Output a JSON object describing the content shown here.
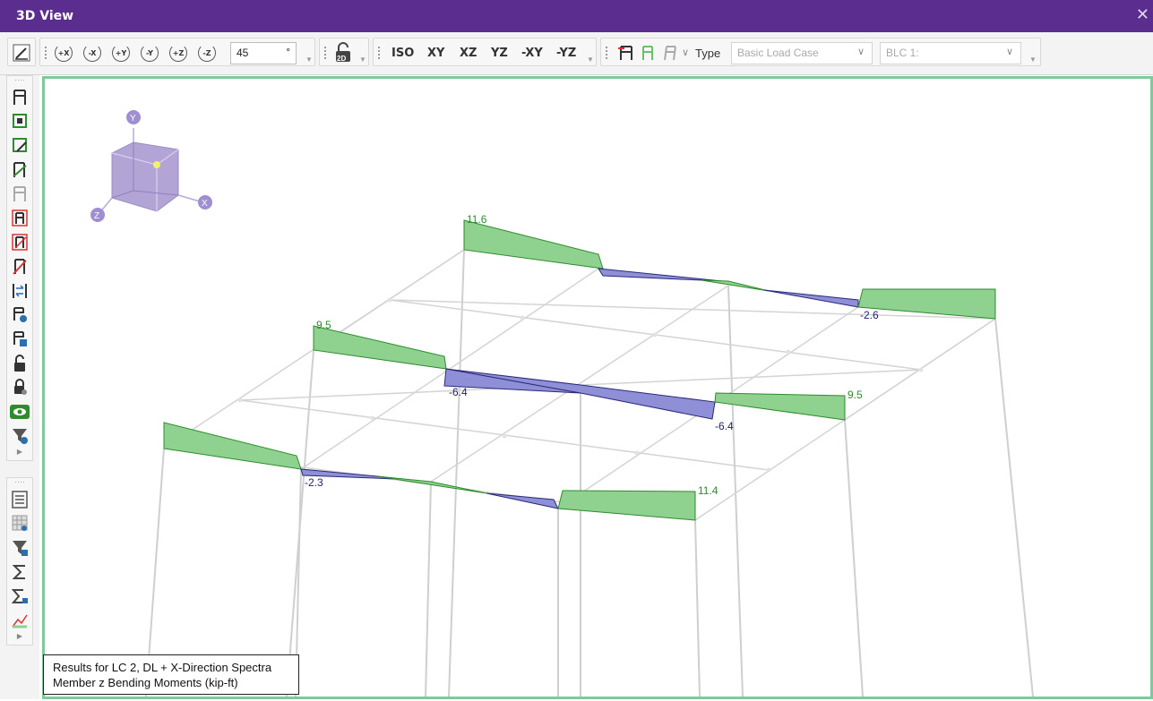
{
  "window": {
    "title": "3D View",
    "close_glyph": "✕"
  },
  "toolbar": {
    "rotate_buttons": [
      "+X",
      "-X",
      "+Y",
      "-Y",
      "+Z",
      "-Z"
    ],
    "rotation_angle": "45",
    "angle_unit": "°",
    "two_d_label": "2D",
    "view_buttons": [
      "ISO",
      "XY",
      "XZ",
      "YZ",
      "-XY",
      "-YZ"
    ],
    "type_label": "Type",
    "type_select": "Basic Load Case",
    "case_select": "BLC 1:"
  },
  "sidebar": {
    "section1": [
      "member-icon",
      "plate-icon",
      "plate-edit-icon",
      "member-edit-icon",
      "member-gray-icon",
      "member-red-icon",
      "member-red-edit-icon",
      "member-delete-icon",
      "member-sync-icon",
      "member-settings-icon",
      "member-save-icon",
      "lock-open-icon",
      "lock-view-icon",
      "eye-icon",
      "filter-icon"
    ],
    "section2": [
      "list-icon",
      "table-icon",
      "filter-list-icon",
      "sum-icon",
      "sum-table-icon",
      "chart-icon"
    ]
  },
  "colors": {
    "titlebar": "#5b2d8e",
    "positive_fill": "#8fd18f",
    "positive_stroke": "#2e8b2e",
    "negative_fill": "#8f8fd8",
    "negative_stroke": "#2a2a7a",
    "frame": "#cfcfcf",
    "viewport_border": "#7fc99a"
  },
  "axis_gizmo": {
    "y": "Y",
    "x": "X",
    "z": "Z"
  },
  "moment_labels": {
    "top_left": "11.6",
    "top_right_neg": "-2.6",
    "mid_left": "9.5",
    "mid_neg_a": "-6.4",
    "mid_right": "9.5",
    "mid_neg_b": "-6.4",
    "front_neg": "-2.3",
    "front_right": "11.4"
  },
  "legend": {
    "line1": "Results for LC 2, DL + X-Direction Spectra",
    "line2": "Member z Bending Moments (kip-ft)"
  }
}
